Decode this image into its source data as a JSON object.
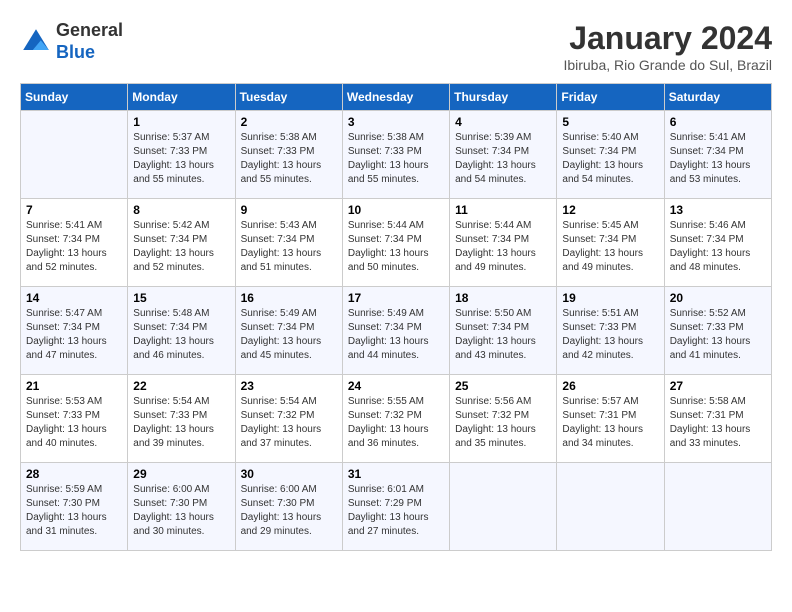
{
  "header": {
    "logo_line1": "General",
    "logo_line2": "Blue",
    "month": "January 2024",
    "location": "Ibiruba, Rio Grande do Sul, Brazil"
  },
  "weekdays": [
    "Sunday",
    "Monday",
    "Tuesday",
    "Wednesday",
    "Thursday",
    "Friday",
    "Saturday"
  ],
  "weeks": [
    [
      {
        "day": "",
        "info": ""
      },
      {
        "day": "1",
        "info": "Sunrise: 5:37 AM\nSunset: 7:33 PM\nDaylight: 13 hours\nand 55 minutes."
      },
      {
        "day": "2",
        "info": "Sunrise: 5:38 AM\nSunset: 7:33 PM\nDaylight: 13 hours\nand 55 minutes."
      },
      {
        "day": "3",
        "info": "Sunrise: 5:38 AM\nSunset: 7:33 PM\nDaylight: 13 hours\nand 55 minutes."
      },
      {
        "day": "4",
        "info": "Sunrise: 5:39 AM\nSunset: 7:34 PM\nDaylight: 13 hours\nand 54 minutes."
      },
      {
        "day": "5",
        "info": "Sunrise: 5:40 AM\nSunset: 7:34 PM\nDaylight: 13 hours\nand 54 minutes."
      },
      {
        "day": "6",
        "info": "Sunrise: 5:41 AM\nSunset: 7:34 PM\nDaylight: 13 hours\nand 53 minutes."
      }
    ],
    [
      {
        "day": "7",
        "info": "Sunrise: 5:41 AM\nSunset: 7:34 PM\nDaylight: 13 hours\nand 52 minutes."
      },
      {
        "day": "8",
        "info": "Sunrise: 5:42 AM\nSunset: 7:34 PM\nDaylight: 13 hours\nand 52 minutes."
      },
      {
        "day": "9",
        "info": "Sunrise: 5:43 AM\nSunset: 7:34 PM\nDaylight: 13 hours\nand 51 minutes."
      },
      {
        "day": "10",
        "info": "Sunrise: 5:44 AM\nSunset: 7:34 PM\nDaylight: 13 hours\nand 50 minutes."
      },
      {
        "day": "11",
        "info": "Sunrise: 5:44 AM\nSunset: 7:34 PM\nDaylight: 13 hours\nand 49 minutes."
      },
      {
        "day": "12",
        "info": "Sunrise: 5:45 AM\nSunset: 7:34 PM\nDaylight: 13 hours\nand 49 minutes."
      },
      {
        "day": "13",
        "info": "Sunrise: 5:46 AM\nSunset: 7:34 PM\nDaylight: 13 hours\nand 48 minutes."
      }
    ],
    [
      {
        "day": "14",
        "info": "Sunrise: 5:47 AM\nSunset: 7:34 PM\nDaylight: 13 hours\nand 47 minutes."
      },
      {
        "day": "15",
        "info": "Sunrise: 5:48 AM\nSunset: 7:34 PM\nDaylight: 13 hours\nand 46 minutes."
      },
      {
        "day": "16",
        "info": "Sunrise: 5:49 AM\nSunset: 7:34 PM\nDaylight: 13 hours\nand 45 minutes."
      },
      {
        "day": "17",
        "info": "Sunrise: 5:49 AM\nSunset: 7:34 PM\nDaylight: 13 hours\nand 44 minutes."
      },
      {
        "day": "18",
        "info": "Sunrise: 5:50 AM\nSunset: 7:34 PM\nDaylight: 13 hours\nand 43 minutes."
      },
      {
        "day": "19",
        "info": "Sunrise: 5:51 AM\nSunset: 7:33 PM\nDaylight: 13 hours\nand 42 minutes."
      },
      {
        "day": "20",
        "info": "Sunrise: 5:52 AM\nSunset: 7:33 PM\nDaylight: 13 hours\nand 41 minutes."
      }
    ],
    [
      {
        "day": "21",
        "info": "Sunrise: 5:53 AM\nSunset: 7:33 PM\nDaylight: 13 hours\nand 40 minutes."
      },
      {
        "day": "22",
        "info": "Sunrise: 5:54 AM\nSunset: 7:33 PM\nDaylight: 13 hours\nand 39 minutes."
      },
      {
        "day": "23",
        "info": "Sunrise: 5:54 AM\nSunset: 7:32 PM\nDaylight: 13 hours\nand 37 minutes."
      },
      {
        "day": "24",
        "info": "Sunrise: 5:55 AM\nSunset: 7:32 PM\nDaylight: 13 hours\nand 36 minutes."
      },
      {
        "day": "25",
        "info": "Sunrise: 5:56 AM\nSunset: 7:32 PM\nDaylight: 13 hours\nand 35 minutes."
      },
      {
        "day": "26",
        "info": "Sunrise: 5:57 AM\nSunset: 7:31 PM\nDaylight: 13 hours\nand 34 minutes."
      },
      {
        "day": "27",
        "info": "Sunrise: 5:58 AM\nSunset: 7:31 PM\nDaylight: 13 hours\nand 33 minutes."
      }
    ],
    [
      {
        "day": "28",
        "info": "Sunrise: 5:59 AM\nSunset: 7:30 PM\nDaylight: 13 hours\nand 31 minutes."
      },
      {
        "day": "29",
        "info": "Sunrise: 6:00 AM\nSunset: 7:30 PM\nDaylight: 13 hours\nand 30 minutes."
      },
      {
        "day": "30",
        "info": "Sunrise: 6:00 AM\nSunset: 7:30 PM\nDaylight: 13 hours\nand 29 minutes."
      },
      {
        "day": "31",
        "info": "Sunrise: 6:01 AM\nSunset: 7:29 PM\nDaylight: 13 hours\nand 27 minutes."
      },
      {
        "day": "",
        "info": ""
      },
      {
        "day": "",
        "info": ""
      },
      {
        "day": "",
        "info": ""
      }
    ]
  ]
}
